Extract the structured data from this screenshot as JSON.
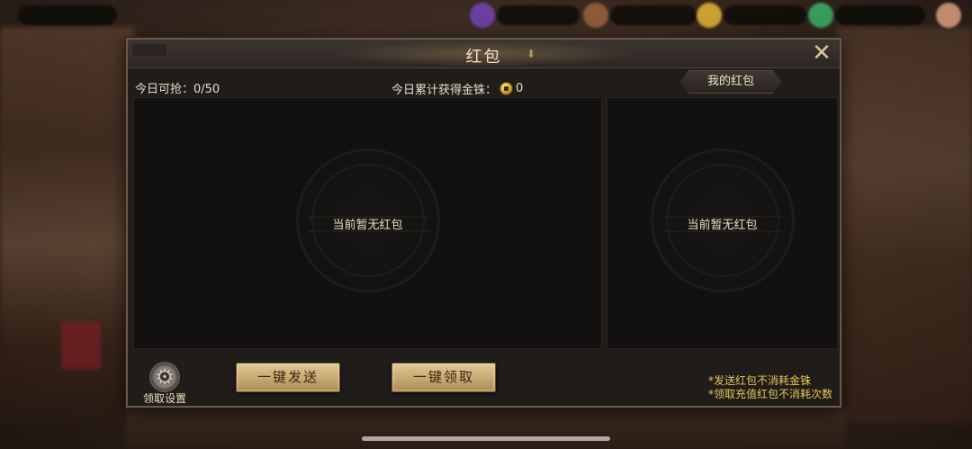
{
  "panel": {
    "title": "红包",
    "today_grab_label": "今日可抢：0/50",
    "today_gold_label": "今日累计获得金铢：",
    "today_gold_value": "0",
    "my_tab_label": "我的红包",
    "left_empty_text": "当前暂无红包",
    "right_empty_text": "当前暂无红包",
    "settings_label": "领取设置",
    "send_button_label": "一键发送",
    "claim_button_label": "一键领取",
    "notes": [
      "*发送红包不消耗金铢",
      "*领取充值红包不消耗次数"
    ]
  },
  "colors": {
    "accent_gold": "#e6c65a",
    "button_gold": "#c9ab74",
    "panel_bg": "#1f1c1a"
  },
  "icons": {
    "close": "close-icon",
    "coin": "gold-coin-icon",
    "settings": "gear-icon",
    "title_arrow": "down-arrow-icon"
  }
}
